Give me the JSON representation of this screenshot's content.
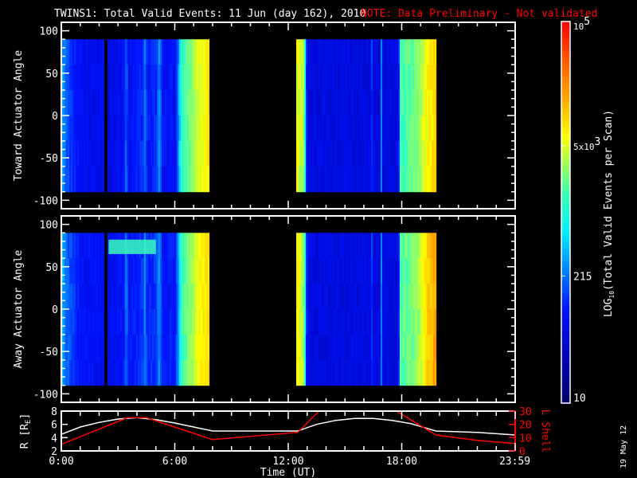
{
  "title": "TWINS1: Total Valid Events: 11 Jun (day 162), 2010",
  "note": "NOTE: Data Preliminary - Not validated",
  "footer_date": "19 May 12",
  "colors": {
    "background": "#000000",
    "axes": "#ffffff",
    "note": "#ff0000",
    "r_line": "#ffffff",
    "lshell_line": "#ff0000"
  },
  "chart_data": [
    {
      "type": "heatmap",
      "ylabel": "Toward Actuator Angle",
      "ylim": [
        -110,
        110
      ],
      "yticks": [
        "100",
        "50",
        "0",
        "-50",
        "-100"
      ],
      "ytick_values": [
        100,
        50,
        0,
        -50,
        -100
      ],
      "xlim_hours": [
        0,
        24
      ],
      "data_angle_range": [
        -90,
        90
      ],
      "segments": [
        {
          "start": 0,
          "end": 2.27,
          "profile": [
            [
              0,
              320
            ],
            [
              0.3,
              150
            ],
            [
              1,
              80
            ],
            [
              2.27,
              70
            ]
          ]
        },
        {
          "start": 2.44,
          "end": 7.8,
          "profile": [
            [
              2.44,
              60
            ],
            [
              3.3,
              90
            ],
            [
              3.4,
              260
            ],
            [
              3.5,
              80
            ],
            [
              4.3,
              120
            ],
            [
              4.4,
              280
            ],
            [
              4.5,
              90
            ],
            [
              5,
              130
            ],
            [
              5.15,
              320
            ],
            [
              5.3,
              90
            ],
            [
              6,
              90
            ],
            [
              6.2,
              400
            ],
            [
              6.3,
              1200
            ],
            [
              6.8,
              2500
            ],
            [
              7.2,
              5000
            ],
            [
              7.8,
              8000
            ]
          ]
        },
        {
          "start": 12.42,
          "end": 19.8,
          "profile": [
            [
              12.42,
              6000
            ],
            [
              12.8,
              3000
            ],
            [
              12.95,
              60
            ],
            [
              16.3,
              60
            ],
            [
              16.35,
              300
            ],
            [
              16.4,
              60
            ],
            [
              16.85,
              60
            ],
            [
              16.9,
              450
            ],
            [
              16.95,
              60
            ],
            [
              17.8,
              60
            ],
            [
              17.85,
              1500
            ],
            [
              18.8,
              2500
            ],
            [
              19.2,
              6000
            ],
            [
              19.8,
              10000
            ]
          ]
        }
      ],
      "bands": []
    },
    {
      "type": "heatmap",
      "ylabel": "Away Actuator Angle",
      "ylim": [
        -110,
        110
      ],
      "yticks": [
        "100",
        "50",
        "0",
        "-50",
        "-100"
      ],
      "ytick_values": [
        100,
        50,
        0,
        -50,
        -100
      ],
      "xlim_hours": [
        0,
        24
      ],
      "data_angle_range": [
        -90,
        90
      ],
      "segments": [
        {
          "start": 0,
          "end": 2.27,
          "profile": [
            [
              0,
              400
            ],
            [
              0.3,
              180
            ],
            [
              1,
              90
            ],
            [
              2.27,
              80
            ]
          ]
        },
        {
          "start": 2.44,
          "end": 7.8,
          "profile": [
            [
              2.44,
              70
            ],
            [
              3.3,
              100
            ],
            [
              3.4,
              300
            ],
            [
              3.5,
              90
            ],
            [
              4.3,
              130
            ],
            [
              4.4,
              300
            ],
            [
              4.5,
              100
            ],
            [
              5,
              150
            ],
            [
              5.15,
              350
            ],
            [
              5.3,
              100
            ],
            [
              6,
              100
            ],
            [
              6.2,
              500
            ],
            [
              6.3,
              1400
            ],
            [
              6.8,
              3000
            ],
            [
              7.2,
              6000
            ],
            [
              7.8,
              9000
            ]
          ]
        },
        {
          "start": 12.42,
          "end": 19.8,
          "profile": [
            [
              12.42,
              7000
            ],
            [
              12.8,
              3000
            ],
            [
              12.95,
              60
            ],
            [
              16.3,
              60
            ],
            [
              16.35,
              350
            ],
            [
              16.4,
              60
            ],
            [
              16.85,
              60
            ],
            [
              16.9,
              500
            ],
            [
              16.95,
              60
            ],
            [
              17.8,
              60
            ],
            [
              17.85,
              1800
            ],
            [
              18.8,
              3000
            ],
            [
              19.2,
              8000
            ],
            [
              19.8,
              20000
            ]
          ]
        }
      ],
      "bands": [
        {
          "start": 2.5,
          "end": 5.0,
          "angle_min": 65,
          "angle_max": 82,
          "value": 1500
        }
      ]
    },
    {
      "type": "line",
      "xlabel": "Time (UT)",
      "xticks": [
        "0:00",
        "6:00",
        "12:00",
        "18:00",
        "23:59"
      ],
      "xtick_hours": [
        0,
        6,
        12,
        18,
        23.98
      ],
      "ylabel_left": "R [R",
      "ylabel_left_sub": "E",
      "ylabel_left_end": "]",
      "ylim_left": [
        2,
        8
      ],
      "yticks_left": [
        "8",
        "6",
        "4",
        "2"
      ],
      "ylabel_right": "L Shell",
      "ylim_right": [
        0,
        30
      ],
      "yticks_right": [
        "30",
        "20",
        "10",
        "0"
      ],
      "series": [
        {
          "axis": "left",
          "color": "#ffffff",
          "points": [
            [
              0,
              4.5
            ],
            [
              1,
              5.6
            ],
            [
              2,
              6.3
            ],
            [
              3,
              6.8
            ],
            [
              4,
              7
            ],
            [
              5,
              6.7
            ],
            [
              6,
              6.2
            ],
            [
              7,
              5.6
            ],
            [
              8,
              5
            ],
            [
              12.5,
              5
            ],
            [
              13.5,
              6
            ],
            [
              14.5,
              6.6
            ],
            [
              15.5,
              6.9
            ],
            [
              16.5,
              6.9
            ],
            [
              17.5,
              6.6
            ],
            [
              18.5,
              6.1
            ],
            [
              19.8,
              5
            ],
            [
              22,
              4.8
            ],
            [
              24,
              4.4
            ]
          ]
        },
        {
          "axis": "right",
          "color": "#ff0000",
          "points": [
            [
              0,
              5
            ],
            [
              3.5,
              25
            ],
            [
              4.5,
              25
            ],
            [
              8,
              8.5
            ],
            [
              12.5,
              14
            ],
            [
              13.7,
              31
            ]
          ]
        },
        {
          "axis": "right",
          "color": "#ff0000",
          "points": [
            [
              17.6,
              31
            ],
            [
              19.8,
              12
            ],
            [
              22,
              8
            ],
            [
              24,
              5.5
            ]
          ]
        }
      ]
    },
    {
      "type": "colorbar",
      "label_prefix": "LOG",
      "label_sub": "10",
      "label_rest": "(Total Valid Events per Scan)",
      "range": [
        10,
        100000
      ],
      "scale": "log",
      "ticks": [
        {
          "value": 10,
          "label": "10"
        },
        {
          "value": 215,
          "label": "215"
        },
        {
          "value": 5000,
          "label_base": "5x10",
          "label_exp": "3"
        },
        {
          "value": 100000,
          "label_base": "10",
          "label_exp": "5"
        }
      ]
    }
  ]
}
